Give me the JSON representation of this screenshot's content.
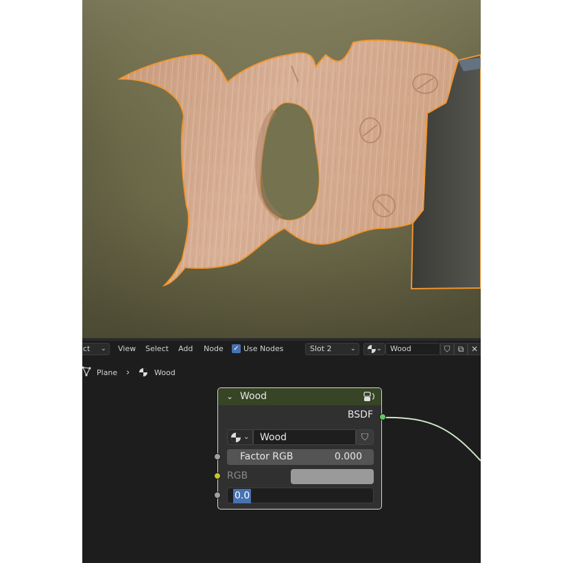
{
  "header": {
    "mode_label": "ct",
    "menus": [
      "View",
      "Select",
      "Add",
      "Node"
    ],
    "use_nodes_label": "Use Nodes",
    "slot_label": "Slot 2",
    "material_name": "Wood"
  },
  "breadcrumb": {
    "object": "Plane",
    "separator": "›",
    "material": "Wood"
  },
  "node": {
    "title": "Wood",
    "output_label": "BSDF",
    "material_name": "Wood",
    "factor_label": "Factor RGB",
    "factor_value": "0.000",
    "rgb_label": "RGB",
    "text_value": "0.0"
  },
  "colors": {
    "selection_outline": "#f0952e",
    "node_header": "#374425",
    "shader_socket": "#63c763",
    "color_socket": "#c7c729",
    "float_socket": "#a1a1a1",
    "accent": "#4772b3"
  }
}
